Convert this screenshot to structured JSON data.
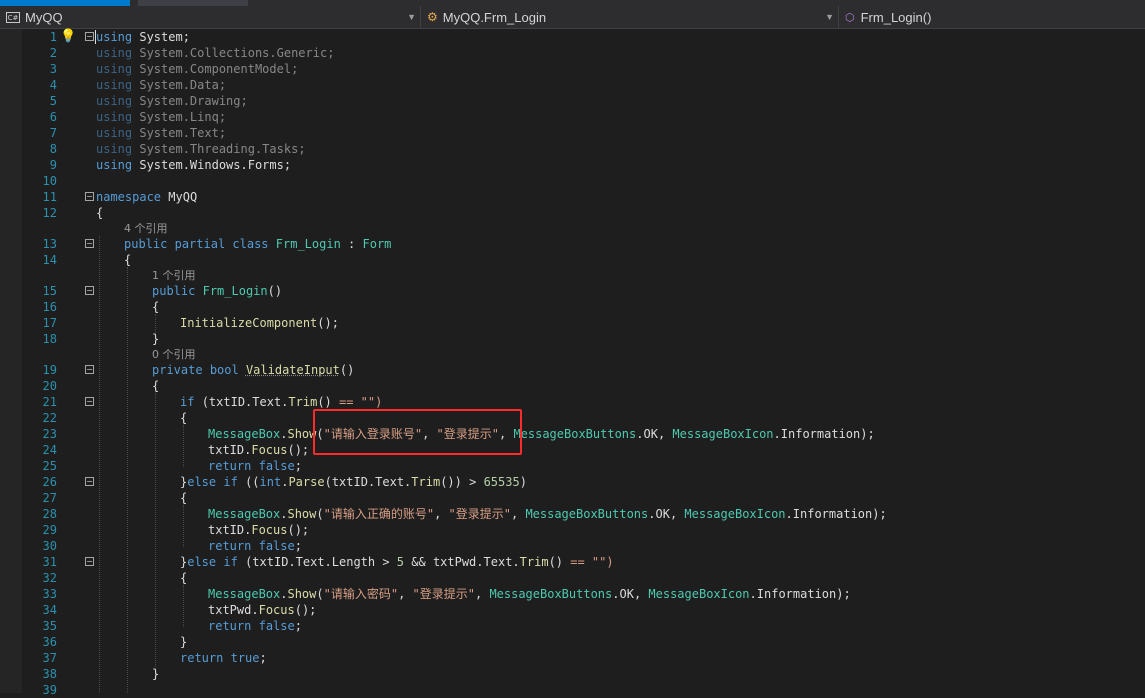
{
  "tabs": [
    "",
    ""
  ],
  "navbar": {
    "project": {
      "icon": "csharp-icon",
      "label": "MyQQ"
    },
    "class": {
      "icon": "class-icon",
      "label": "MyQQ.Frm_Login"
    },
    "member": {
      "icon": "method-icon",
      "label": "Frm_Login()"
    }
  },
  "line_numbers": [
    "1",
    "2",
    "3",
    "4",
    "5",
    "6",
    "7",
    "8",
    "9",
    "10",
    "11",
    "12",
    "13",
    "14",
    "15",
    "16",
    "17",
    "18",
    "19",
    "20",
    "21",
    "22",
    "23",
    "24",
    "25",
    "26",
    "27",
    "28",
    "29",
    "30",
    "31",
    "32",
    "33",
    "34",
    "35",
    "36",
    "37",
    "38",
    "39"
  ],
  "refs": {
    "class_refs": "4 个引用",
    "ctor_refs": "1 个引用",
    "method_refs": "0 个引用"
  },
  "code": {
    "using_kw": "using",
    "ns_system": "System",
    "ns_collections": "System.Collections.Generic",
    "ns_componentmodel": "System.ComponentModel",
    "ns_data": "System.Data",
    "ns_drawing": "System.Drawing",
    "ns_linq": "System.Linq",
    "ns_text": "System.Text",
    "ns_tasks": "System.Threading.Tasks",
    "ns_forms": "System.Windows.Forms",
    "semi": ";",
    "namespace_kw": "namespace",
    "namespace_name": "MyQQ",
    "lbrace": "{",
    "rbrace": "}",
    "public_kw": "public",
    "partial_kw": "partial",
    "class_kw": "class",
    "private_kw": "private",
    "bool_kw": "bool",
    "if_kw": "if",
    "else_kw": "else",
    "int_kw": "int",
    "return_kw": "return",
    "false_kw": "false",
    "true_kw": "true",
    "class_name": "Frm_Login",
    "colon": ":",
    "form_type": "Form",
    "paren_open": "(",
    "paren_close": ")",
    "empty_parens": "()",
    "init_component": "InitializeComponent",
    "call_end": "();",
    "validate_input": "ValidateInput",
    "txtid": "txtID",
    "txtpwd": "txtPwd",
    "dot_text": ".Text.",
    "trim": "Trim",
    "eq_empty": " == \"\")",
    "eq_empty_close": " == \"\")",
    "messagebox": "MessageBox",
    "dot": ".",
    "show": "Show",
    "focus": "Focus",
    "parse": "Parse",
    "msg_login": "\"请输入登录账号\"",
    "msg_id": "\"请输入正确的账号\"",
    "msg_pwd": "\"请输入密码\"",
    "title": "\"登录提示\"",
    "comma": ", ",
    "mbb": "MessageBoxButtons",
    "ok_sep": ".OK, ",
    "mbi": "MessageBoxIcon",
    "info_end": ".Information);",
    "gt": ") > ",
    "num": "65535",
    "close_paren": ")",
    "len_part": ".Text.Length > ",
    "five": "5",
    "and": " && "
  }
}
